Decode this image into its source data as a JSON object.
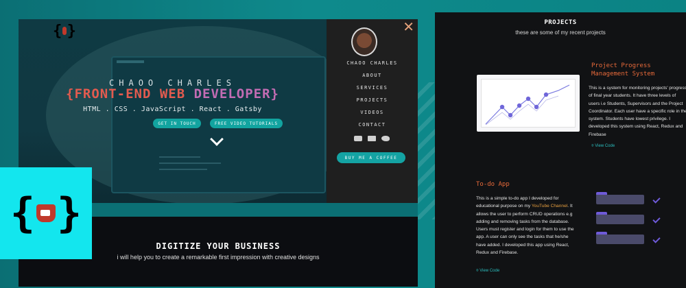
{
  "left_shot": {
    "hero": {
      "name": "CHAOO CHARLES",
      "title_open": "{FRONT-END WEB ",
      "title_close": "DEVELOPER}",
      "skills": "HTML . CSS . JavaScript . React . Gatsby",
      "btn_contact": "GET IN TOUCH",
      "btn_tutorials": "FREE VIDEO TUTORIALS"
    },
    "menu": {
      "close": "✕",
      "name": "CHAOO CHARLES",
      "items": [
        "ABOUT",
        "SERVICES",
        "PROJECTS",
        "VIDEOS",
        "CONTACT"
      ],
      "coffee": "BUY ME A COFFEE",
      "social_icons": [
        "youtube-icon",
        "dev-icon",
        "twitter-icon"
      ]
    },
    "section2": {
      "title": "DIGITIZE YOUR BUSINESS",
      "subtitle": "i will help you to create a remarkable first impression with creative designs"
    }
  },
  "right_shot": {
    "title": "PROJECTS",
    "subtitle": "these are some of my recent projects",
    "project1": {
      "title": "Project Progress Management System",
      "desc": "This is a system for monitoring projects' progress of final year students. It have three levels of users i.e Students, Supervisors and the Project Coordinator. Each user have a specific role in the system. Students have lowest privilege. I developed this system using React, Redux and Firebase",
      "view_code": "View Code"
    },
    "project2": {
      "title": "To-do App",
      "desc_before": "This is a simple to-do app I developed for educational purpose on my ",
      "desc_link": "YouTube Channel",
      "desc_after": ". It allows the user to perform CRUD operations e.g adding and removing tasks from the database. Users must register and login for them to use the app. A user can only see the tasks that he/she have added. I developed this app using React, Redux and Firebase.",
      "view_code": "View Code"
    }
  },
  "colors": {
    "accent": "#13a4a0",
    "orange": "#e86a3a",
    "purple": "#6e5ad8",
    "cyan_logo": "#13e6ee"
  }
}
